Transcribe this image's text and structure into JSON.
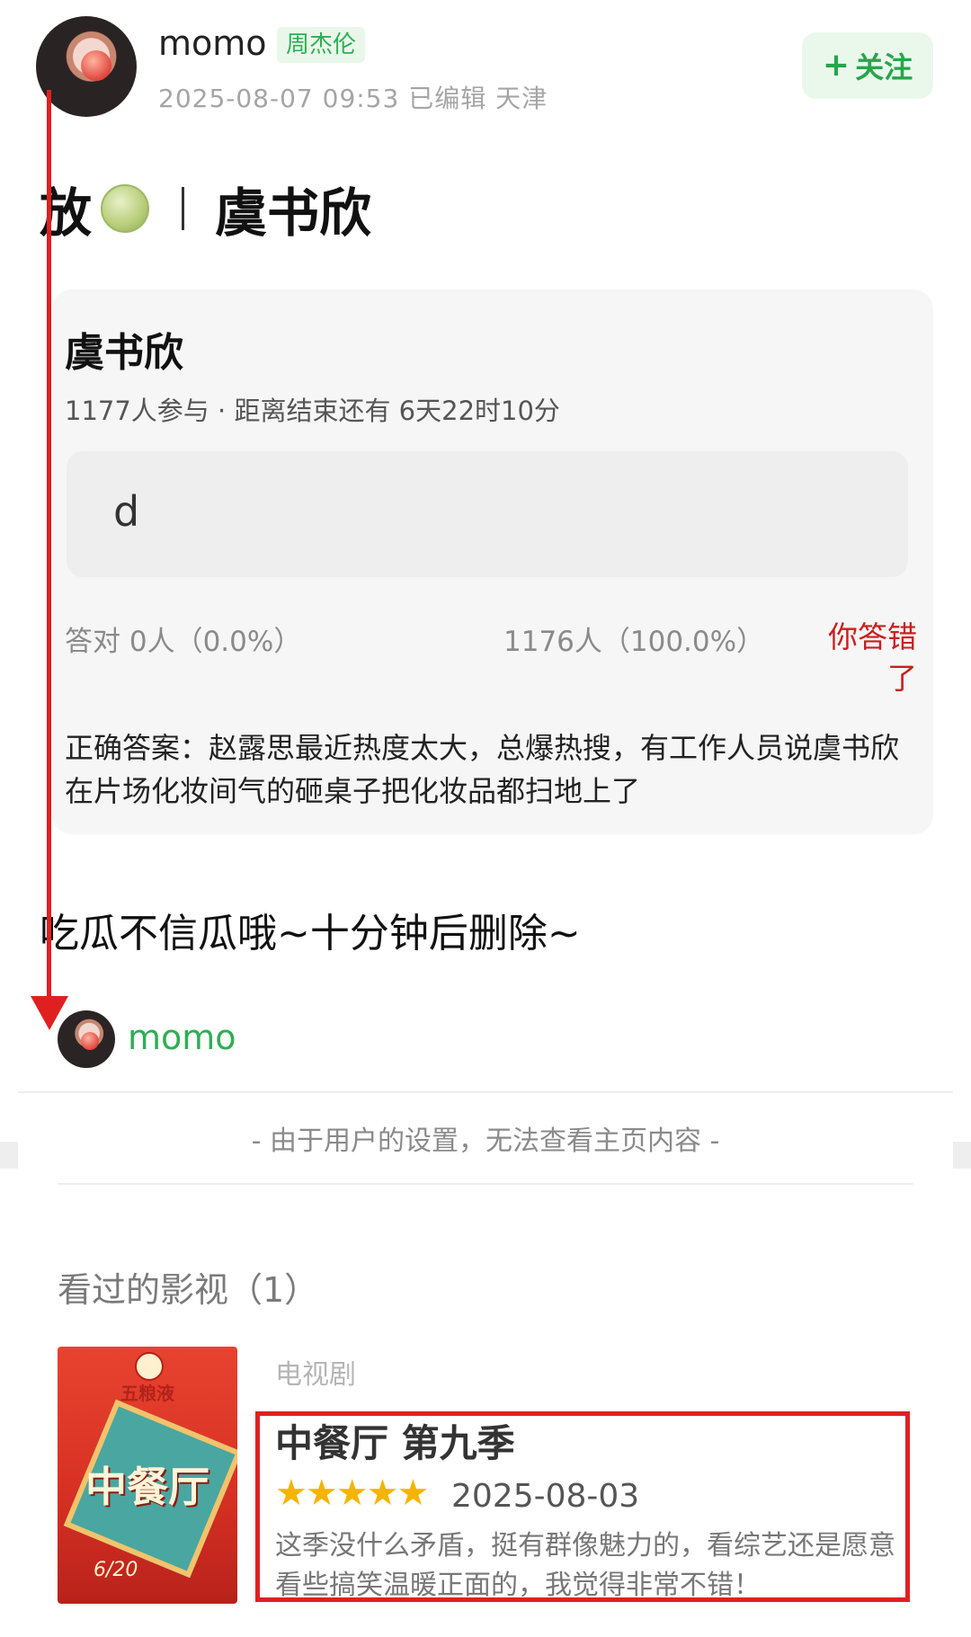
{
  "post": {
    "author": "momo",
    "tag": "周杰伦",
    "meta": "2025-08-07 09:53  已编辑  天津",
    "follow_label": "关注",
    "title_left": "放",
    "title_right": "虞书欣"
  },
  "vote": {
    "title": "虞书欣",
    "subtitle": "1177人参与 · 距离结束还有 6天22时10分",
    "option": "d",
    "correct_stats": "答对  0人（0.0%）",
    "wrong_stats": "1176人（100.0%）",
    "result": "你答错了",
    "answer": "正确答案：赵露思最近热度太大，总爆热搜，有工作人员说虞书欣在片场化妆间气的砸桌子把化妆品都扫地上了"
  },
  "caption": "吃瓜不信瓜哦~十分钟后删除~",
  "profile": {
    "name": "momo",
    "privacy": "- 由于用户的设置，无法查看主页内容 -"
  },
  "watched": {
    "section_title": "看过的影视（1）",
    "item": {
      "type": "电视剧",
      "title": "中餐厅 第九季",
      "rating_stars": 5,
      "stars_text": "★★★★★",
      "date": "2025-08-03",
      "review": "这季没什么矛盾，挺有群像魅力的，看综艺还是愿意看些搞笑温暖正面的，我觉得非常不错！",
      "poster_brand": "五粮液",
      "poster_title": "中餐厅",
      "poster_date": "6/20"
    }
  },
  "colors": {
    "accent_green": "#2fae55",
    "error_red": "#c91f1f",
    "annotation_red": "#e02020",
    "star": "#f5b400"
  }
}
